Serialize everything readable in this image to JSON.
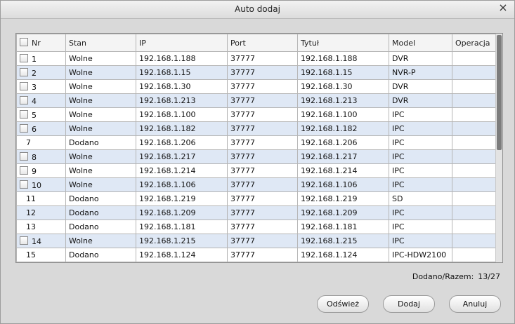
{
  "dialog": {
    "title": "Auto dodaj",
    "close_glyph": "×"
  },
  "table": {
    "headers": {
      "nr": "Nr",
      "stan": "Stan",
      "ip": "IP",
      "port": "Port",
      "tytul": "Tytuł",
      "model": "Model",
      "operacja": "Operacja"
    },
    "rows": [
      {
        "nr": "1",
        "stan": "Wolne",
        "ip": "192.168.1.188",
        "port": "37777",
        "tytul": "192.168.1.188",
        "model": "DVR",
        "operacja": "",
        "checkbox": true
      },
      {
        "nr": "2",
        "stan": "Wolne",
        "ip": "192.168.1.15",
        "port": "37777",
        "tytul": "192.168.1.15",
        "model": "NVR-P",
        "operacja": "",
        "checkbox": true
      },
      {
        "nr": "3",
        "stan": "Wolne",
        "ip": "192.168.1.30",
        "port": "37777",
        "tytul": "192.168.1.30",
        "model": "DVR",
        "operacja": "",
        "checkbox": true
      },
      {
        "nr": "4",
        "stan": "Wolne",
        "ip": "192.168.1.213",
        "port": "37777",
        "tytul": "192.168.1.213",
        "model": "DVR",
        "operacja": "",
        "checkbox": true
      },
      {
        "nr": "5",
        "stan": "Wolne",
        "ip": "192.168.1.100",
        "port": "37777",
        "tytul": "192.168.1.100",
        "model": "IPC",
        "operacja": "",
        "checkbox": true
      },
      {
        "nr": "6",
        "stan": "Wolne",
        "ip": "192.168.1.182",
        "port": "37777",
        "tytul": "192.168.1.182",
        "model": "IPC",
        "operacja": "",
        "checkbox": true
      },
      {
        "nr": "7",
        "stan": "Dodano",
        "ip": "192.168.1.206",
        "port": "37777",
        "tytul": "192.168.1.206",
        "model": "IPC",
        "operacja": "",
        "checkbox": false
      },
      {
        "nr": "8",
        "stan": "Wolne",
        "ip": "192.168.1.217",
        "port": "37777",
        "tytul": "192.168.1.217",
        "model": "IPC",
        "operacja": "",
        "checkbox": true
      },
      {
        "nr": "9",
        "stan": "Wolne",
        "ip": "192.168.1.214",
        "port": "37777",
        "tytul": "192.168.1.214",
        "model": "IPC",
        "operacja": "",
        "checkbox": true
      },
      {
        "nr": "10",
        "stan": "Wolne",
        "ip": "192.168.1.106",
        "port": "37777",
        "tytul": "192.168.1.106",
        "model": "IPC",
        "operacja": "",
        "checkbox": true
      },
      {
        "nr": "11",
        "stan": "Dodano",
        "ip": "192.168.1.219",
        "port": "37777",
        "tytul": "192.168.1.219",
        "model": "SD",
        "operacja": "",
        "checkbox": false
      },
      {
        "nr": "12",
        "stan": "Dodano",
        "ip": "192.168.1.209",
        "port": "37777",
        "tytul": "192.168.1.209",
        "model": "IPC",
        "operacja": "",
        "checkbox": false
      },
      {
        "nr": "13",
        "stan": "Dodano",
        "ip": "192.168.1.181",
        "port": "37777",
        "tytul": "192.168.1.181",
        "model": "IPC",
        "operacja": "",
        "checkbox": false
      },
      {
        "nr": "14",
        "stan": "Wolne",
        "ip": "192.168.1.215",
        "port": "37777",
        "tytul": "192.168.1.215",
        "model": "IPC",
        "operacja": "",
        "checkbox": true
      },
      {
        "nr": "15",
        "stan": "Dodano",
        "ip": "192.168.1.124",
        "port": "37777",
        "tytul": "192.168.1.124",
        "model": "IPC-HDW2100",
        "operacja": "",
        "checkbox": false
      }
    ]
  },
  "summary": {
    "label": "Dodano/Razem:",
    "value": "13/27"
  },
  "buttons": {
    "refresh": "Odśwież",
    "add": "Dodaj",
    "cancel": "Anuluj"
  },
  "colors": {
    "row_alt": "#dfe8f5",
    "scroll_thumb": "#7c7c7c"
  }
}
